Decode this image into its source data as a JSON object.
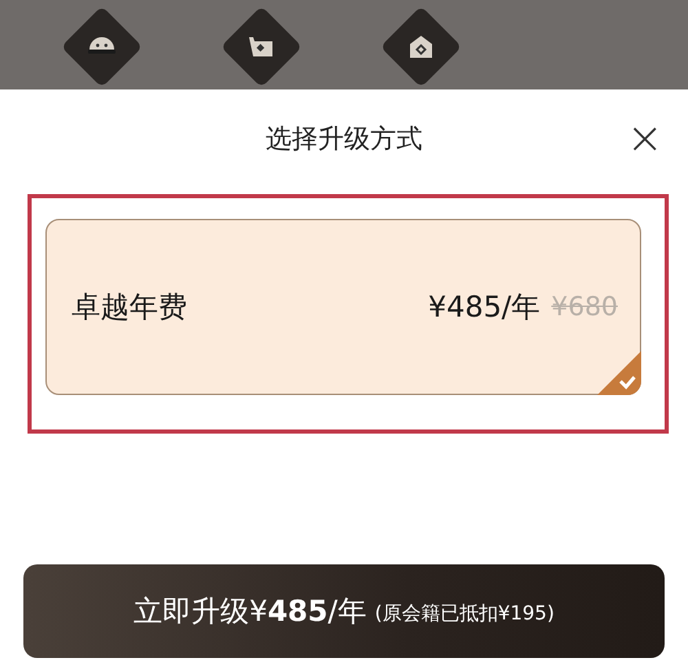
{
  "background_icons": [
    {
      "kind": "face"
    },
    {
      "kind": "cart"
    },
    {
      "kind": "house"
    }
  ],
  "sheet": {
    "title": "选择升级方式",
    "close_label": "×"
  },
  "plans": [
    {
      "name": "卓越年费",
      "price": "¥485/年",
      "original_price": "¥680",
      "selected": true
    }
  ],
  "upgrade_button": {
    "label": "立即升级¥**485**/年",
    "note": "(原会籍已抵扣¥195)"
  }
}
